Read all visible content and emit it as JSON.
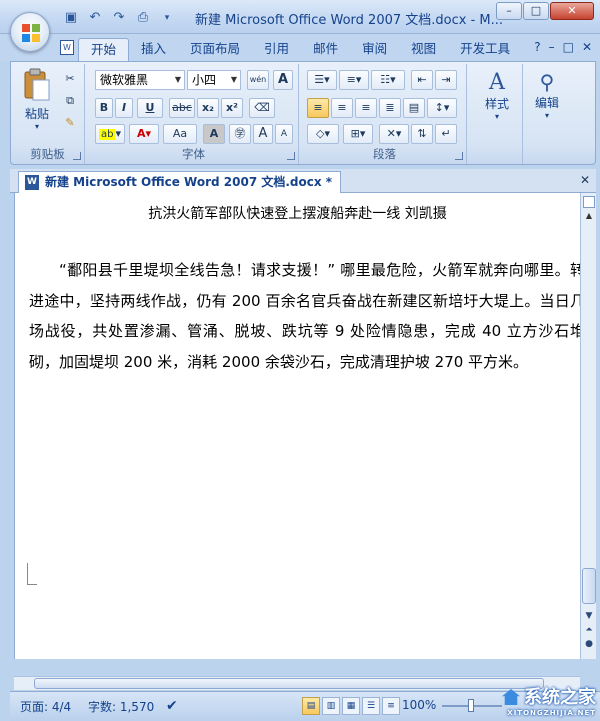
{
  "window": {
    "title": "新建 Microsoft Office Word 2007 文档.docx - M...",
    "minimize": "–",
    "restore": "□",
    "close": "✕"
  },
  "ribbon_tabs": [
    "开始",
    "插入",
    "页面布局",
    "引用",
    "邮件",
    "审阅",
    "视图",
    "开发工具"
  ],
  "ribbon_tabs_right": {
    "help": "?",
    "min": "–",
    "restore": "□",
    "close": "✕"
  },
  "clipboard": {
    "paste": "粘贴",
    "label": "剪贴板"
  },
  "font": {
    "name": "微软雅黑",
    "size": "小四",
    "wen": "wén",
    "bold": "B",
    "italic": "I",
    "underline": "U",
    "strike": "abc",
    "sub": "x₂",
    "sup": "x²",
    "grow": "A",
    "shrink": "A",
    "aa": "Aa",
    "label": "字体"
  },
  "paragraph": {
    "label": "段落"
  },
  "styles": {
    "label": "样式"
  },
  "editing": {
    "label": "编辑"
  },
  "document_tab": {
    "label": "新建 Microsoft Office Word 2007 文档.docx *",
    "close": "✕"
  },
  "document": {
    "caption": "抗洪火箭军部队快速登上摆渡船奔赴一线 刘凯摄",
    "paragraph": "“鄱阳县千里堤坝全线告急！请求支援！” 哪里最危险，火箭军就奔向哪里。转进途中，坚持两线作战，仍有 200 百余名官兵奋战在新建区新培圩大堤上。当日几场战役，共处置渗漏、管涌、脱坡、跌坑等 9 处险情隐患，完成 40 立方沙石堆砌，加固堤坝 200 米，消耗 2000 余袋沙石，完成清理护坡 270 平方米。"
  },
  "status": {
    "page": "页面: 4/4",
    "words": "字数: 1,570",
    "zoom": "100%"
  },
  "watermark": {
    "text": "系统之家",
    "sub": "XITONGZHIJIA.NET"
  }
}
